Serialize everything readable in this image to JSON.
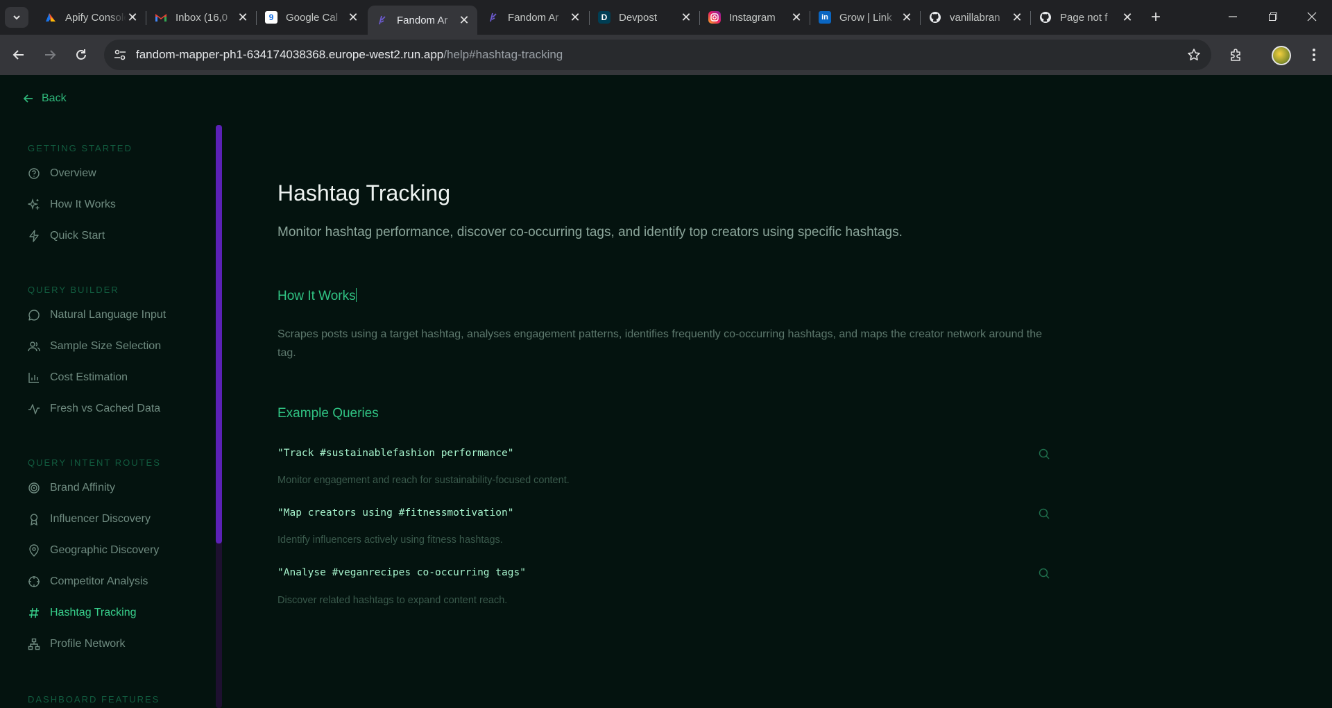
{
  "browser": {
    "tabs": [
      {
        "title": "Apify Console",
        "icon": "apify-icon"
      },
      {
        "title": "Inbox (16,0",
        "icon": "gmail-icon"
      },
      {
        "title": "Google Cal",
        "icon": "google-calendar-icon"
      },
      {
        "title": "Fandom Ar",
        "icon": "fandom-icon",
        "active": true
      },
      {
        "title": "Fandom Ar",
        "icon": "fandom-icon"
      },
      {
        "title": "Devpost",
        "icon": "devpost-icon"
      },
      {
        "title": "Instagram",
        "icon": "instagram-icon"
      },
      {
        "title": "Grow | Link",
        "icon": "linkedin-icon"
      },
      {
        "title": "vanillabran",
        "icon": "github-icon"
      },
      {
        "title": "Page not f",
        "icon": "github-icon"
      }
    ],
    "url_host": "fandom-mapper-ph1-634174038368.europe-west2.run.app",
    "url_path": "/help#hashtag-tracking"
  },
  "back_label": "Back",
  "sidebar": {
    "sections": [
      {
        "title": "GETTING STARTED",
        "items": [
          {
            "label": "Overview",
            "icon": "help-circle-icon"
          },
          {
            "label": "How It Works",
            "icon": "sparkles-icon"
          },
          {
            "label": "Quick Start",
            "icon": "lightning-icon"
          }
        ]
      },
      {
        "title": "QUERY BUILDER",
        "items": [
          {
            "label": "Natural Language Input",
            "icon": "chat-bubble-icon"
          },
          {
            "label": "Sample Size Selection",
            "icon": "users-icon"
          },
          {
            "label": "Cost Estimation",
            "icon": "bar-chart-icon"
          },
          {
            "label": "Fresh vs Cached Data",
            "icon": "activity-icon"
          }
        ]
      },
      {
        "title": "QUERY INTENT ROUTES",
        "items": [
          {
            "label": "Brand Affinity",
            "icon": "target-icon"
          },
          {
            "label": "Influencer Discovery",
            "icon": "award-icon"
          },
          {
            "label": "Geographic Discovery",
            "icon": "map-pin-icon"
          },
          {
            "label": "Competitor Analysis",
            "icon": "crosshair-icon"
          },
          {
            "label": "Hashtag Tracking",
            "icon": "hash-icon",
            "active": true
          },
          {
            "label": "Profile Network",
            "icon": "network-icon"
          }
        ]
      },
      {
        "title": "DASHBOARD FEATURES",
        "items": []
      }
    ]
  },
  "main": {
    "title": "Hashtag Tracking",
    "subtitle": "Monitor hashtag performance, discover co-occurring tags, and identify top creators using specific hashtags.",
    "how_heading": "How It Works",
    "how_text": "Scrapes posts using a target hashtag, analyses engagement patterns, identifies frequently co-occurring hashtags, and maps the creator network around the tag.",
    "examples_heading": "Example Queries",
    "examples": [
      {
        "query": "\"Track #sustainablefashion performance\"",
        "desc": "Monitor engagement and reach for sustainability-focused content."
      },
      {
        "query": "\"Map creators using #fitnessmotivation\"",
        "desc": "Identify influencers actively using fitness hashtags."
      },
      {
        "query": "\"Analyse #veganrecipes co-occurring tags\"",
        "desc": "Discover related hashtags to expand content reach."
      }
    ]
  }
}
